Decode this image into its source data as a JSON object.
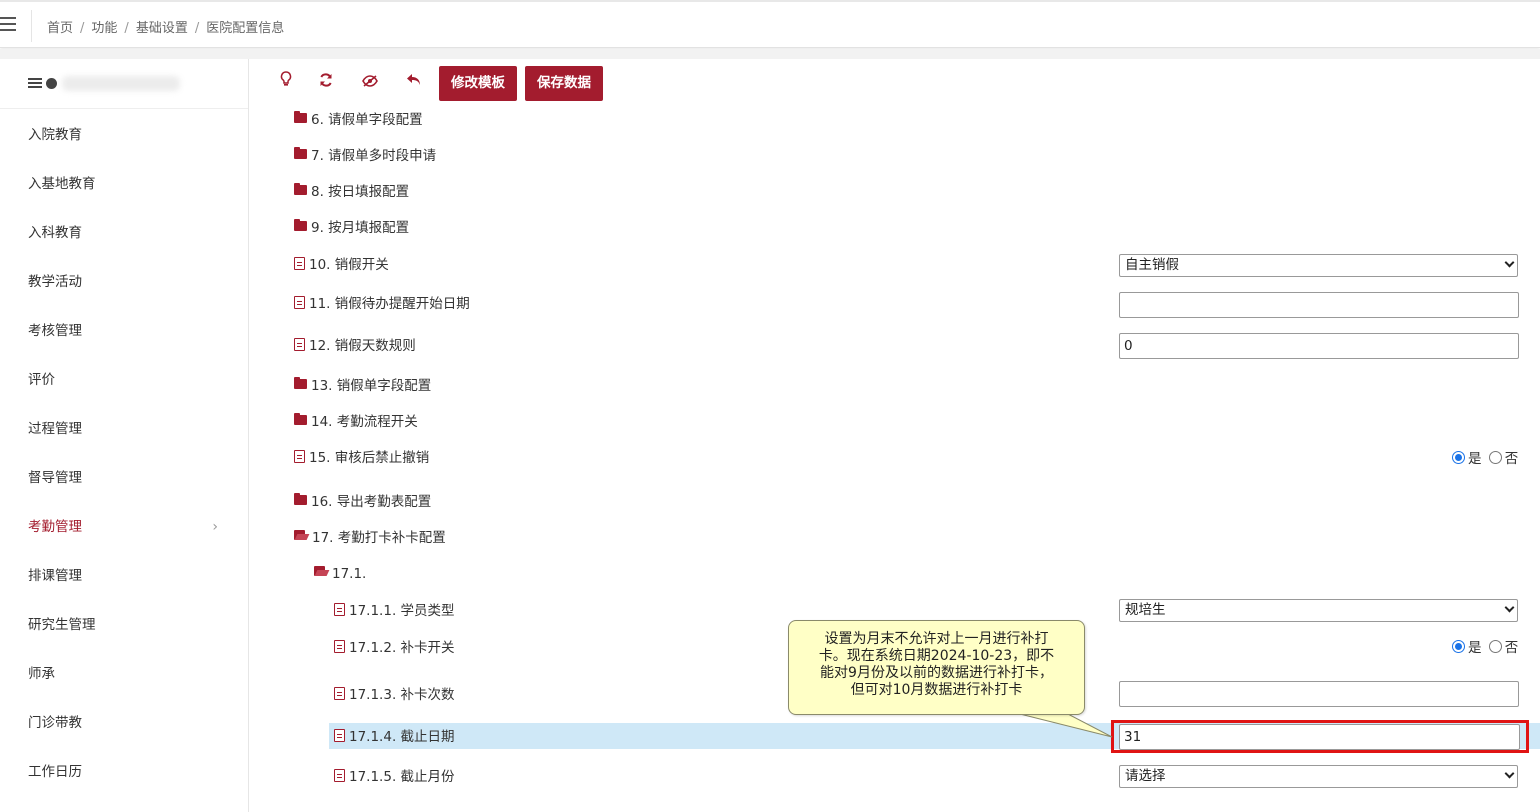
{
  "breadcrumb": [
    "首页",
    "功能",
    "基础设置",
    "医院配置信息"
  ],
  "sidebar": {
    "items": [
      {
        "label": "入院教育",
        "active": false
      },
      {
        "label": "入基地教育",
        "active": false
      },
      {
        "label": "入科教育",
        "active": false
      },
      {
        "label": "教学活动",
        "active": false
      },
      {
        "label": "考核管理",
        "active": false
      },
      {
        "label": "评价",
        "active": false
      },
      {
        "label": "过程管理",
        "active": false
      },
      {
        "label": "督导管理",
        "active": false
      },
      {
        "label": "考勤管理",
        "active": true
      },
      {
        "label": "排课管理",
        "active": false
      },
      {
        "label": "研究生管理",
        "active": false
      },
      {
        "label": "师承",
        "active": false
      },
      {
        "label": "门诊带教",
        "active": false
      },
      {
        "label": "工作日历",
        "active": false
      }
    ],
    "active_chevron": "›"
  },
  "toolbar": {
    "icons": [
      "bulb-icon",
      "refresh-icon",
      "eye-slash-icon",
      "undo-icon"
    ],
    "edit_template_label": "修改模板",
    "save_data_label": "保存数据"
  },
  "tree": {
    "r6": "6. 请假单字段配置",
    "r7": "7. 请假单多时段申请",
    "r8": "8. 按日填报配置",
    "r9": "9. 按月填报配置",
    "r10": "10. 销假开关",
    "r10_value": "自主销假",
    "r11": "11. 销假待办提醒开始日期",
    "r11_value": "",
    "r12": "12. 销假天数规则",
    "r12_value": "0",
    "r13": "13. 销假单字段配置",
    "r14": "14. 考勤流程开关",
    "r15": "15. 审核后禁止撤销",
    "r16": "16. 导出考勤表配置",
    "r17": "17. 考勤打卡补卡配置",
    "r17_1": "17.1.",
    "r17_1_1": "17.1.1. 学员类型",
    "r17_1_1_value": "规培生",
    "r17_1_2": "17.1.2. 补卡开关",
    "r17_1_3": "17.1.3. 补卡次数",
    "r17_1_3_value": "",
    "r17_1_4": "17.1.4. 截止日期",
    "r17_1_4_value": "31",
    "r17_1_5": "17.1.5. 截止月份",
    "r17_1_5_value": "请选择",
    "yes_label": "是",
    "no_label": "否"
  },
  "callout": {
    "text": "设置为月末不允许对上一月进行补打卡。现在系统日期2024-10-23，即不能对9月份及以前的数据进行补打卡，但可对10月数据进行补打卡",
    "line1": "设置为月末不允许对上一月进行补打",
    "line2": "卡。现在系统日期2024-10-23，即不",
    "line3": "能对9月份及以前的数据进行补打卡，",
    "line4": "但可对10月数据进行补打卡"
  },
  "colors": {
    "accent": "#a31c2e",
    "highlight_row": "#cfe8f7",
    "callout_bg": "#ffffc6",
    "annotation_red": "#e01414"
  }
}
